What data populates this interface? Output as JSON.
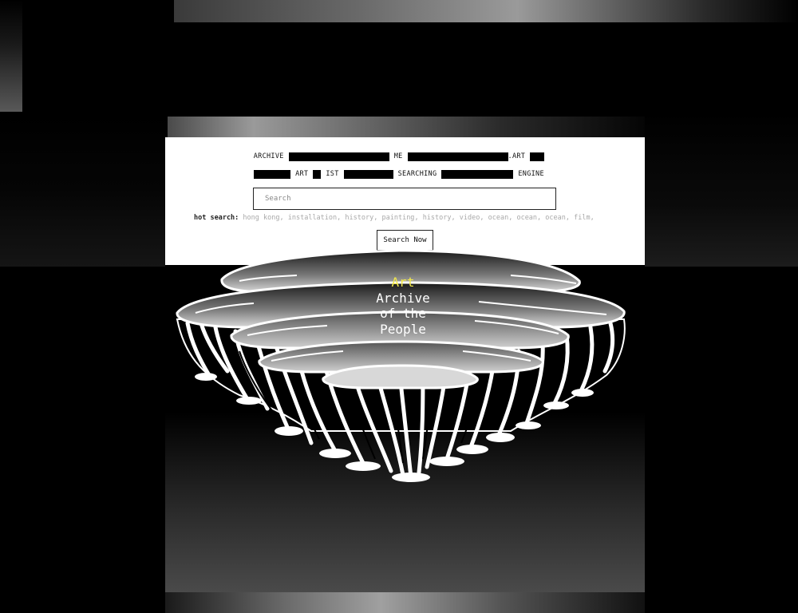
{
  "header": {
    "line1": [
      "ARCHIVE",
      "ME",
      ".ART"
    ],
    "line2": [
      "ART",
      "IST",
      "SEARCHING",
      "ENGINE"
    ]
  },
  "search": {
    "placeholder": "Search",
    "button_label": "Search Now"
  },
  "hot_search": {
    "label": "hot search:",
    "tags": [
      "hong kong",
      "installation",
      "history",
      "painting",
      "history",
      "video",
      "ocean",
      "ocean",
      "ocean",
      "film"
    ]
  },
  "title": {
    "accent": "Art",
    "lines": [
      "Archive",
      "of the",
      "People"
    ],
    "accent_color": "#f2e84a"
  },
  "icons": {
    "logo": "floating-island-icon"
  }
}
